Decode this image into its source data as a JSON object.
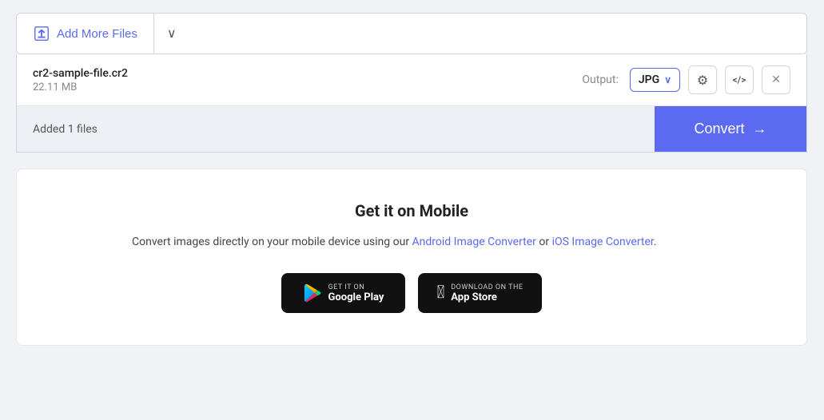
{
  "toolbar": {
    "add_files_label": "Add More Files",
    "dropdown_label": "▾"
  },
  "file": {
    "name": "cr2-sample-file.cr2",
    "size": "22.11 MB",
    "output_label": "Output:",
    "output_format": "JPG"
  },
  "bottom_bar": {
    "files_count": "Added 1 files",
    "convert_label": "Convert",
    "arrow": "→"
  },
  "mobile_section": {
    "title": "Get it on Mobile",
    "description_prefix": "Convert images directly on your mobile device using our ",
    "android_link_text": "Android Image Converter",
    "or_text": " or ",
    "ios_link_text": "iOS Image Converter",
    "description_suffix": ".",
    "google_play": {
      "get_it_on": "GET IT ON",
      "store_name": "Google Play"
    },
    "app_store": {
      "download_on": "Download on the",
      "store_name": "App Store"
    }
  },
  "icons": {
    "settings": "⚙",
    "code": "</>",
    "close": "✕",
    "chevron": "∨",
    "arrow_right": "→"
  }
}
